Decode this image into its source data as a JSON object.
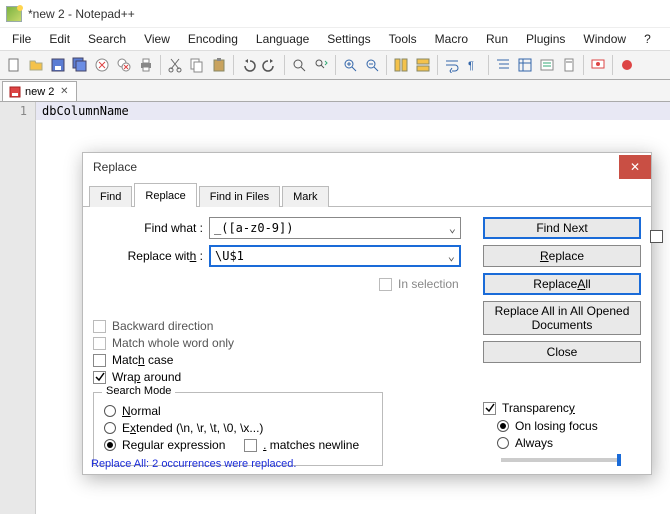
{
  "window": {
    "title": "*new 2 - Notepad++"
  },
  "menubar": [
    "File",
    "Edit",
    "Search",
    "View",
    "Encoding",
    "Language",
    "Settings",
    "Tools",
    "Macro",
    "Run",
    "Plugins",
    "Window",
    "?"
  ],
  "tab": {
    "name": "new 2"
  },
  "editor": {
    "line1_num": "1",
    "line1_text": "dbColumnName"
  },
  "dialog": {
    "title": "Replace",
    "tabs": {
      "find": "Find",
      "replace": "Replace",
      "findinfiles": "Find in Files",
      "mark": "Mark"
    },
    "find_label": "Find what :",
    "find_value": "_([a-z0-9])",
    "replace_label": "Replace with :",
    "replace_value": "\\U$1",
    "inselection": "In selection",
    "backward": "Backward direction",
    "wholeword": "Match whole word only",
    "matchcase": "Match case",
    "wrap": "Wrap around",
    "buttons": {
      "findnext": "Find Next",
      "replace": "Replace",
      "replaceall": "Replace All",
      "replaceall_opened": "Replace All in All Opened Documents",
      "close": "Close"
    },
    "searchmode": {
      "legend": "Search Mode",
      "normal": "Normal",
      "extended": "Extended (\\n, \\r, \\t, \\0, \\x...)",
      "regex": "Regular expression",
      "dotnewline": ". matches newline"
    },
    "transparency": {
      "label": "Transparency",
      "onlosing": "On losing focus",
      "always": "Always"
    },
    "status": "Replace All: 2 occurrences were replaced."
  }
}
